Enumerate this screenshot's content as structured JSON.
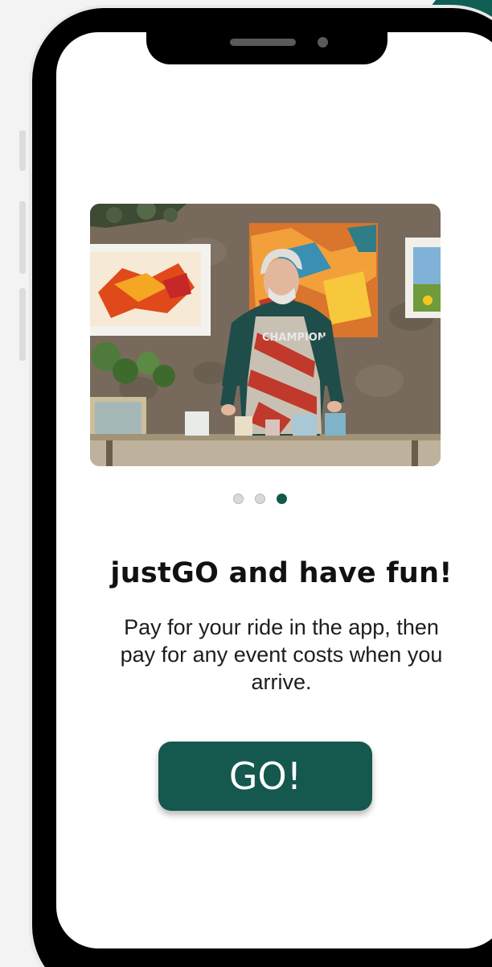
{
  "onboarding": {
    "title": "justGO and have fun!",
    "description": "Pay for your ride in the app, then pay for any event costs when you arrive.",
    "cta_label": "GO!",
    "pagination": {
      "total": 3,
      "active_index": 2
    }
  },
  "image": {
    "subject": "artist painting outdoors at a table in front of a stone wall with paintings",
    "apron_text": "CHAMPION"
  },
  "colors": {
    "accent": "#14584e",
    "dot_inactive": "#d9d9d9",
    "phone_frame": "#000000",
    "screen_bg": "#ffffff"
  }
}
